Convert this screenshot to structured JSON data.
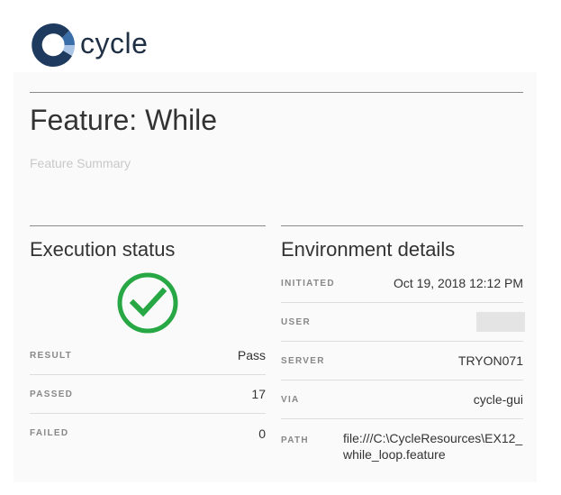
{
  "brand": {
    "name": "cycle",
    "logo_colors": {
      "dark": "#1f3a5f",
      "mid": "#3a6ea8",
      "light": "#a9c4e4"
    }
  },
  "feature": {
    "title": "Feature: While",
    "summary": "Feature Summary"
  },
  "execution_status": {
    "title": "Execution status",
    "status_icon": "check-circle-icon",
    "status_color": "#27a844",
    "rows": [
      {
        "label": "RESULT",
        "value": "Pass"
      },
      {
        "label": "PASSED",
        "value": "17"
      },
      {
        "label": "FAILED",
        "value": "0"
      }
    ]
  },
  "environment": {
    "title": "Environment details",
    "rows": [
      {
        "label": "INITIATED",
        "value": "Oct 19, 2018 12:12 PM"
      },
      {
        "label": "USER",
        "value": ""
      },
      {
        "label": "SERVER",
        "value": "TRYON071"
      },
      {
        "label": "VIA",
        "value": "cycle-gui"
      },
      {
        "label": "PATH",
        "value": "file:///C:\\CycleResources\\EX12_while_loop.feature"
      }
    ]
  }
}
